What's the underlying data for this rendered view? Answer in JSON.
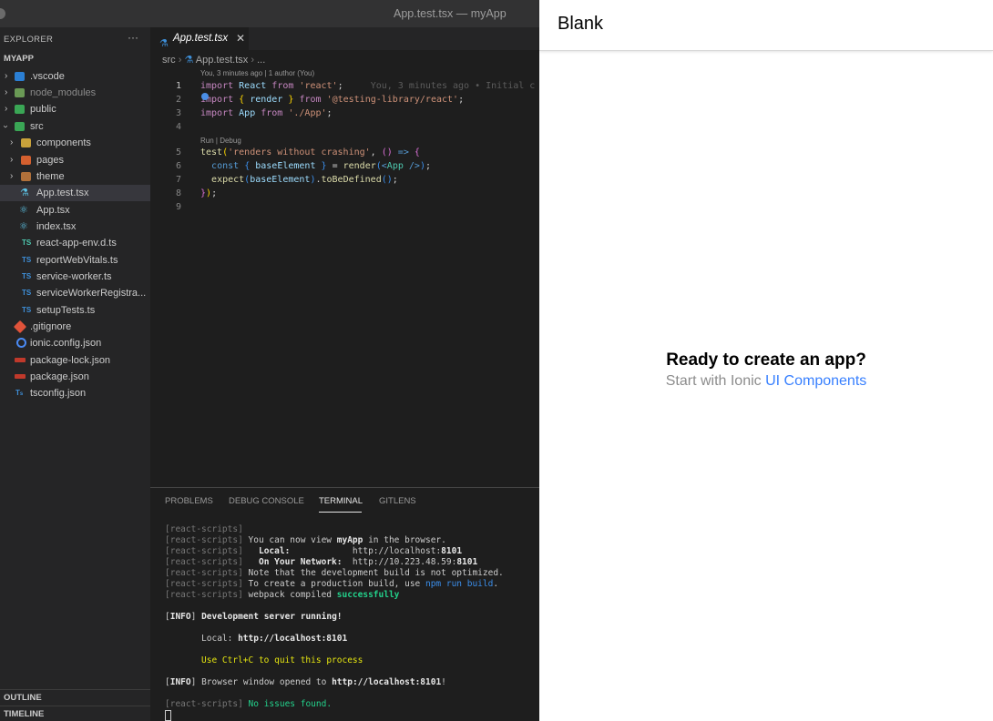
{
  "window": {
    "title": "App.test.tsx — myApp"
  },
  "explorer": {
    "header": "EXPLORER",
    "more": "···",
    "root": "MYAPP",
    "items": [
      {
        "label": ".vscode"
      },
      {
        "label": "node_modules"
      },
      {
        "label": "public"
      },
      {
        "label": "src"
      },
      {
        "label": "components"
      },
      {
        "label": "pages"
      },
      {
        "label": "theme"
      },
      {
        "label": "App.test.tsx"
      },
      {
        "label": "App.tsx"
      },
      {
        "label": "index.tsx"
      },
      {
        "label": "react-app-env.d.ts"
      },
      {
        "label": "reportWebVitals.ts"
      },
      {
        "label": "service-worker.ts"
      },
      {
        "label": "serviceWorkerRegistra..."
      },
      {
        "label": "setupTests.ts"
      },
      {
        "label": ".gitignore"
      },
      {
        "label": "ionic.config.json"
      },
      {
        "label": "package-lock.json"
      },
      {
        "label": "package.json"
      },
      {
        "label": "tsconfig.json"
      }
    ],
    "outline": "OUTLINE",
    "timeline": "TIMELINE"
  },
  "editor": {
    "tab_label": "App.test.tsx",
    "breadcrumb_folder": "src",
    "breadcrumb_file": "App.test.tsx",
    "breadcrumb_more": "...",
    "blame_lens": "You, 3 minutes ago | 1 author (You)",
    "inline_blame": "You, 3 minutes ago • Initial c",
    "run_lens": "Run | Debug",
    "line_numbers": [
      "1",
      "2",
      "3",
      "4",
      "5",
      "6",
      "7",
      "8",
      "9"
    ]
  },
  "panel": {
    "tabs": [
      "PROBLEMS",
      "DEBUG CONSOLE",
      "TERMINAL",
      "GITLENS"
    ],
    "active_tab": "TERMINAL"
  },
  "browser": {
    "title": "Blank",
    "heading": "Ready to create an app?",
    "start_text": "Start with Ionic",
    "link_text": "UI Components"
  }
}
